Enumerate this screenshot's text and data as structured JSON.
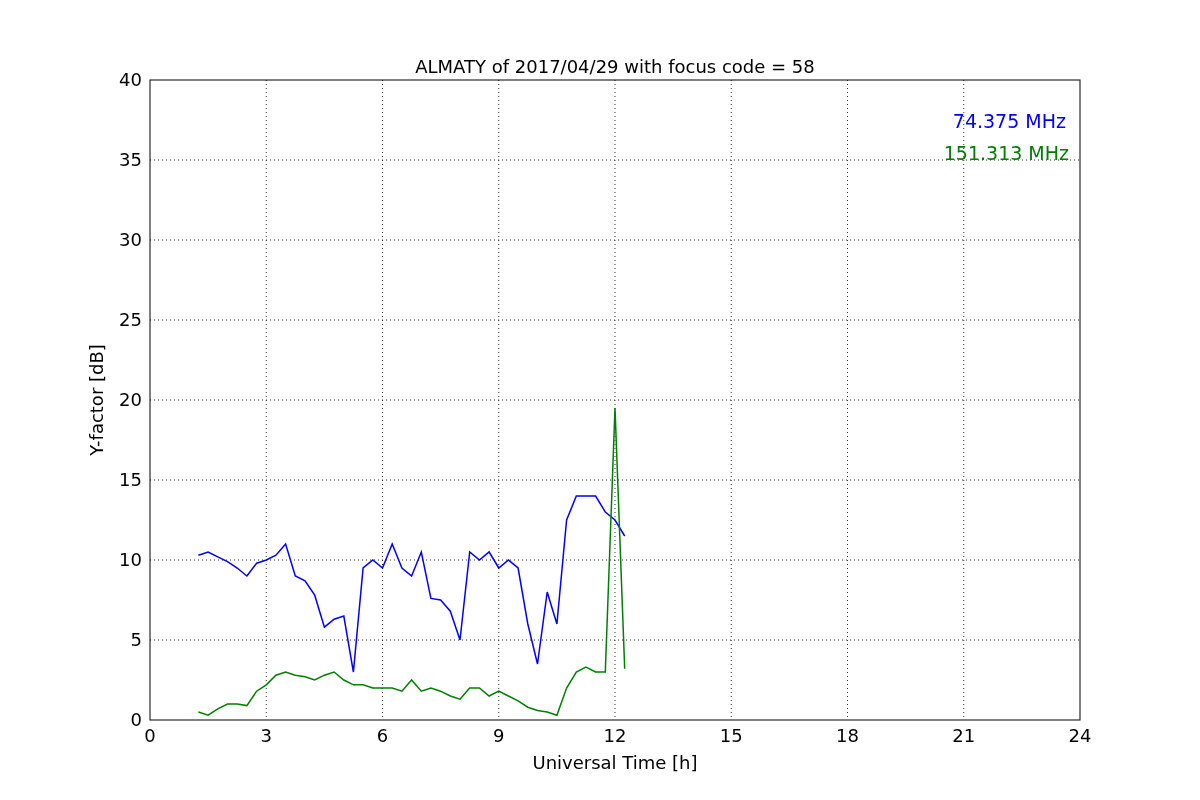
{
  "figure": {
    "chart_data": {
      "type": "line",
      "title": "ALMATY of 2017/04/29 with focus code = 58",
      "xlabel": "Universal Time [h]",
      "ylabel": "Y-factor [dB]",
      "x": [
        1.25,
        1.5,
        1.75,
        2.0,
        2.25,
        2.5,
        2.75,
        3.0,
        3.25,
        3.5,
        3.75,
        4.0,
        4.25,
        4.5,
        4.75,
        5.0,
        5.25,
        5.5,
        5.75,
        6.0,
        6.25,
        6.5,
        6.75,
        7.0,
        7.25,
        7.5,
        7.75,
        8.0,
        8.25,
        8.5,
        8.75,
        9.0,
        9.25,
        9.5,
        9.75,
        10.0,
        10.25,
        10.5,
        10.75,
        11.0,
        11.25,
        11.5,
        11.75,
        12.0,
        12.25
      ],
      "series": [
        {
          "name": "74.375 MHz",
          "color": "#0000ff",
          "values": [
            10.3,
            10.5,
            10.2,
            9.9,
            9.5,
            9.0,
            9.8,
            10.0,
            10.3,
            11.0,
            9.0,
            8.7,
            7.8,
            5.8,
            6.3,
            6.5,
            3.0,
            9.5,
            10.0,
            9.5,
            11.0,
            9.5,
            9.0,
            10.5,
            7.6,
            7.5,
            6.8,
            5.0,
            10.5,
            10.0,
            10.5,
            9.5,
            10.0,
            9.5,
            6.0,
            3.5,
            8.0,
            6.0,
            12.5,
            14.0,
            14.0,
            14.0,
            13.0,
            12.5,
            11.5
          ]
        },
        {
          "name": "151.313 MHz",
          "color": "#008000",
          "values": [
            0.5,
            0.3,
            0.7,
            1.0,
            1.0,
            0.9,
            1.8,
            2.2,
            2.8,
            3.0,
            2.8,
            2.7,
            2.5,
            2.8,
            3.0,
            2.5,
            2.2,
            2.2,
            2.0,
            2.0,
            2.0,
            1.8,
            2.5,
            1.8,
            2.0,
            1.8,
            1.5,
            1.3,
            2.0,
            2.0,
            1.5,
            1.8,
            1.5,
            1.2,
            0.8,
            0.6,
            0.5,
            0.3,
            2.0,
            3.0,
            3.3,
            3.0,
            3.0,
            19.5,
            3.2
          ]
        }
      ],
      "grid": true,
      "xlim": [
        0,
        24
      ],
      "ylim": [
        0,
        40
      ],
      "xticks": [
        0,
        3,
        6,
        9,
        12,
        15,
        18,
        21,
        24
      ],
      "yticks": [
        0,
        5,
        10,
        15,
        20,
        25,
        30,
        35,
        40
      ]
    }
  }
}
